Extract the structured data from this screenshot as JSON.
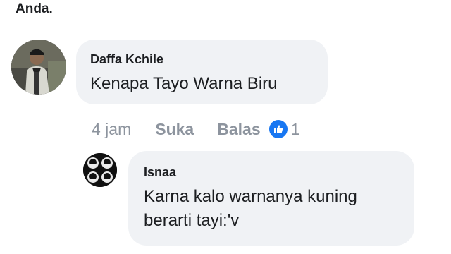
{
  "header_text": "Anda.",
  "comment": {
    "author": "Daffa Kchile",
    "text": "Kenapa Tayo Warna Biru",
    "time": "4 jam",
    "like_label": "Suka",
    "reply_label": "Balas",
    "like_count": "1",
    "like_icon": "thumbs-up-icon",
    "accent_color": "#1877f2"
  },
  "reply": {
    "author": "Isnaa",
    "text": "Karna kalo warnanya kuning berarti tayi:'v"
  }
}
